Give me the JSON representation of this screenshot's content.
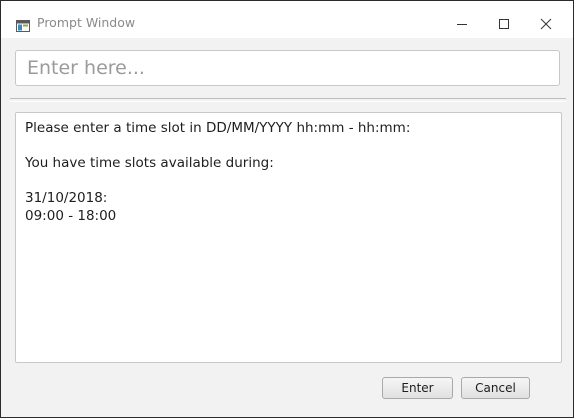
{
  "window": {
    "title": "Prompt Window",
    "icon": "app-window-icon",
    "controls": [
      "minimize-icon",
      "maximize-icon",
      "close-icon"
    ]
  },
  "input": {
    "placeholder": "Enter here...",
    "value": ""
  },
  "message": {
    "line1": "Please enter a time slot in DD/MM/YYYY hh:mm - hh:mm:",
    "line2": "You have time slots available during:",
    "date": "31/10/2018:",
    "slot": "09:00 - 18:00"
  },
  "buttons": {
    "enter": "Enter",
    "cancel": "Cancel"
  }
}
